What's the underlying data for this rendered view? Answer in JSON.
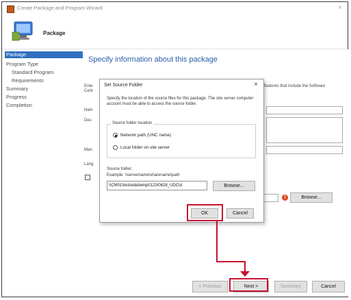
{
  "window": {
    "title": "Create Package and Program Wizard",
    "close_glyph": "×",
    "header_title": "Package",
    "header_icon": "computer-package-icon"
  },
  "sidebar": {
    "items": [
      {
        "label": "Package",
        "active": true
      },
      {
        "label": "Program Type"
      },
      {
        "label": "Standard Program"
      },
      {
        "label": "Requirements"
      },
      {
        "label": "Summary"
      },
      {
        "label": "Progress"
      },
      {
        "label": "Completion"
      }
    ]
  },
  "main": {
    "heading": "Specify information about this package",
    "intro_left": "Ente",
    "intro_left_2": "Cent",
    "intro_right": "features that include the Software",
    "fields": {
      "name_label": "Nam",
      "description_label": "Des",
      "manufacturer_label": "Man",
      "language_label": "Lang"
    },
    "browse_label": "Browse...",
    "warning_glyph": "!"
  },
  "modal": {
    "title": "Set Source Folder",
    "close_glyph": "×",
    "description": "Specify the location of the source files for this package. The site server computer account must be able to access the source folder.",
    "group_label": "Source folder location",
    "options": [
      {
        "label": "Network path (UNC name)",
        "selected": true
      },
      {
        "label": "Local folder on site server",
        "selected": false
      }
    ],
    "source_folder_label": "Source folder:",
    "example_text": "Example: \\\\servername\\sharename\\path",
    "source_folder_value": "\\\\CM01\\test\\eda\\temp0123\\0628_UDC\\d",
    "browse_label": "Browse...",
    "ok_label": "OK",
    "cancel_label": "Cancel"
  },
  "footer": {
    "previous_label": "< Previous",
    "next_label": "Next >",
    "summary_label": "Summary",
    "cancel_label": "Cancel"
  },
  "colors": {
    "accent": "#2f6fc0",
    "heading": "#2b5ea8",
    "annotation": "#c8102e"
  }
}
